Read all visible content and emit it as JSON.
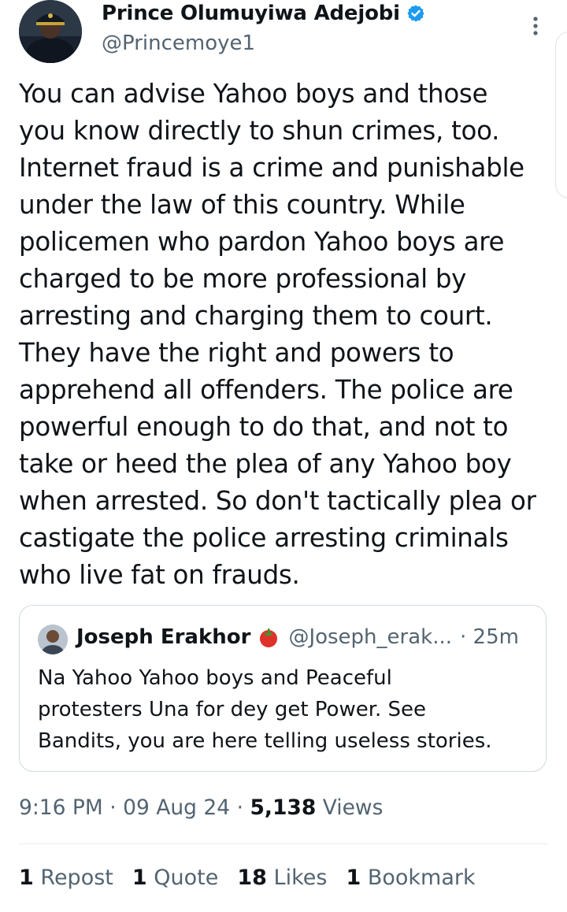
{
  "author": {
    "display_name": "Prince Olumuyiwa Adejobi",
    "handle": "@Princemoye1",
    "verified": true
  },
  "tweet": {
    "lines": [
      "You can advise Yahoo boys and those",
      "you know directly to shun crimes, too.",
      "Internet fraud is a crime and punishable",
      "under the law of this country. While",
      "policemen who pardon Yahoo boys are",
      "charged to be more professional by",
      "arresting and charging them to court.",
      "They have the right and powers to",
      "apprehend all offenders. The police are",
      "powerful enough to do that, and not to",
      "take or heed the plea of any Yahoo boy",
      "when arrested. So don't tactically plea or",
      "castigate the police arresting criminals",
      "who live fat on frauds."
    ]
  },
  "quote": {
    "display_name": "Joseph Erakhor",
    "handle": "@Joseph_erak...",
    "time": "· 25m",
    "lines": [
      "Na Yahoo Yahoo boys and Peaceful",
      "protesters Una for dey get Power. See",
      "Bandits, you are here telling useless stories."
    ]
  },
  "meta": {
    "time": "9:16 PM",
    "date": "09 Aug 24",
    "views_count": "5,138",
    "views_label": "Views",
    "separator": "·"
  },
  "stats": {
    "reposts": {
      "count": "1",
      "label": "Repost"
    },
    "quotes": {
      "count": "1",
      "label": "Quote"
    },
    "likes": {
      "count": "18",
      "label": "Likes"
    },
    "bookmarks": {
      "count": "1",
      "label": "Bookmark"
    }
  },
  "colors": {
    "text_primary": "#0f1419",
    "text_secondary": "#536471",
    "verified_blue": "#1d9bf0",
    "border": "#cfd9de"
  }
}
